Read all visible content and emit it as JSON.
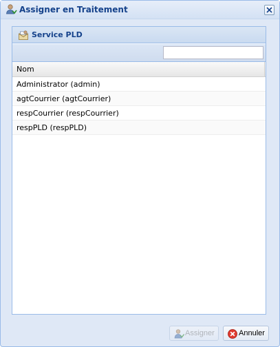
{
  "window": {
    "title": "Assigner en Traitement",
    "icon": "user-assign-icon"
  },
  "panel": {
    "title": "Service PLD",
    "icon": "service-icon"
  },
  "search": {
    "value": "",
    "placeholder": ""
  },
  "grid": {
    "columns": [
      "Nom"
    ],
    "rows": [
      "Administrator (admin)",
      "agtCourrier (agtCourrier)",
      "respCourrier (respCourrier)",
      "respPLD (respPLD)"
    ]
  },
  "footer": {
    "assign_label": "Assigner",
    "cancel_label": "Annuler",
    "assign_enabled": false
  },
  "colors": {
    "title_text": "#15428b",
    "border": "#99bbe8",
    "window_bg": "#dfe8f6"
  }
}
